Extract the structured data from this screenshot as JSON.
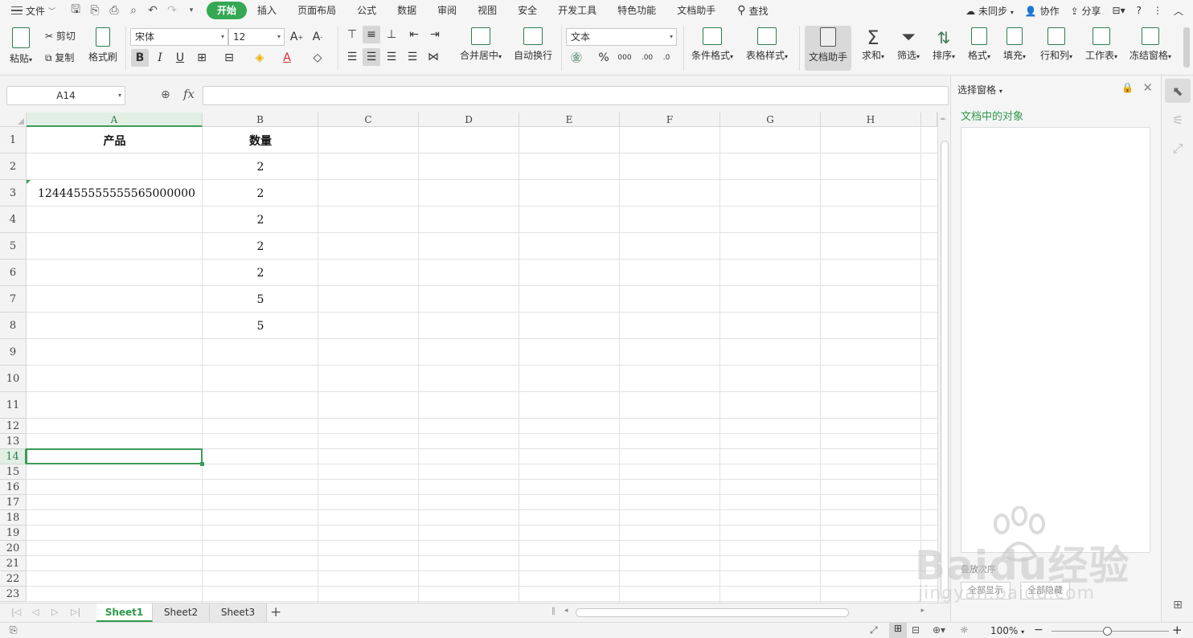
{
  "menubar": {
    "file_label": "文件",
    "tabs": [
      "开始",
      "插入",
      "页面布局",
      "公式",
      "数据",
      "审阅",
      "视图",
      "安全",
      "开发工具",
      "特色功能",
      "文档助手"
    ],
    "active_tab": "开始",
    "search_label": "查找",
    "sync_label": "未同步",
    "collab_label": "协作",
    "share_label": "分享"
  },
  "ribbon": {
    "paste": "粘贴",
    "cut": "剪切",
    "copy": "复制",
    "format_painter": "格式刷",
    "font_name": "宋体",
    "font_size": "12",
    "merge_center": "合并居中",
    "wrap_text": "自动换行",
    "number_format": "文本",
    "conditional_format": "条件格式",
    "table_style": "表格样式",
    "doc_assistant": "文档助手",
    "sum": "求和",
    "filter": "筛选",
    "sort": "排序",
    "format": "格式",
    "fill": "填充",
    "rows_cols": "行和列",
    "worksheet": "工作表",
    "freeze_panes": "冻结窗格"
  },
  "formula_bar": {
    "name_box": "A14",
    "fx_label": "fx",
    "formula": ""
  },
  "grid": {
    "columns": [
      "A",
      "B",
      "C",
      "D",
      "E",
      "F",
      "G",
      "H"
    ],
    "selected_column": "A",
    "rows": [
      "1",
      "2",
      "3",
      "4",
      "5",
      "6",
      "7",
      "8",
      "9",
      "10",
      "11",
      "12",
      "13",
      "14",
      "15",
      "16",
      "17",
      "18",
      "19",
      "20",
      "21",
      "22",
      "23"
    ],
    "selected_row": "14",
    "cells": {
      "A1": "产品",
      "B1": "数量",
      "A3": "1244455555555565000000",
      "B2": "2",
      "B3": "2",
      "B4": "2",
      "B5": "2",
      "B6": "2",
      "B7": "5",
      "B8": "5"
    }
  },
  "sheets": {
    "tabs": [
      "Sheet1",
      "Sheet2",
      "Sheet3"
    ],
    "active": "Sheet1"
  },
  "statusbar": {
    "zoom": "100%"
  },
  "pane": {
    "title": "选择窗格",
    "subtitle": "文档中的对象",
    "order_label": "叠放次序",
    "show_all": "全部显示",
    "hide_all": "全部隐藏"
  },
  "watermark": {
    "brand": "Baidu经验",
    "url": "jingyan.baidu.com"
  },
  "colors": {
    "accent": "#34a853",
    "selection": "#3d9b58"
  }
}
